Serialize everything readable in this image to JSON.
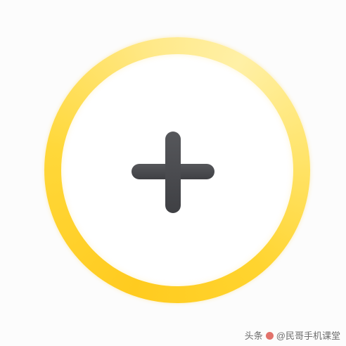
{
  "page": {
    "title": "",
    "background_color": "#fcfcfc"
  },
  "add_button": {
    "icon": "plus-icon",
    "ring_color": "#ffd42f",
    "icon_color": "#4a4b4f"
  },
  "watermark": {
    "prefix": "头条",
    "text": "@民哥手机课堂",
    "mark_color": "#d8382e"
  }
}
